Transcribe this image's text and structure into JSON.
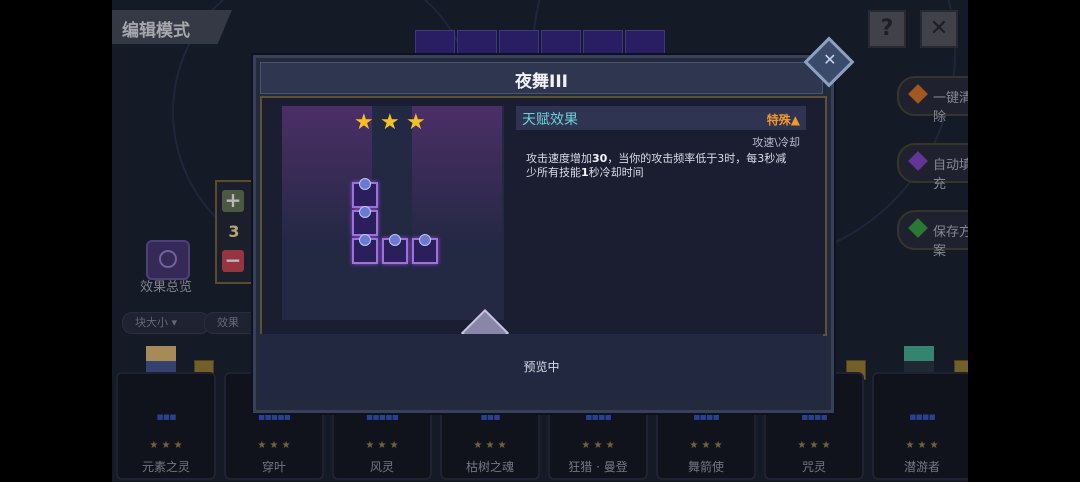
{
  "header": {
    "mode_title": "编辑模式",
    "help_label": "?",
    "close_label": "✕"
  },
  "right_actions": [
    {
      "label": "一键清除",
      "color": "#e07a2a"
    },
    {
      "label": "自动填充",
      "color": "#8a4ad0"
    },
    {
      "label": "保存方案",
      "color": "#3aa84a"
    }
  ],
  "stepper": {
    "plus": "+",
    "value": "3",
    "minus": "−"
  },
  "effect_summary": {
    "label": "效果总览"
  },
  "filters": [
    {
      "label": "块大小 ▾"
    },
    {
      "label": "效果"
    }
  ],
  "cards": [
    {
      "name": "元素之灵",
      "stars": "★ ★ ★",
      "shape": "▪▪▪"
    },
    {
      "name": "穿叶",
      "stars": "★ ★ ★",
      "shape": "▪▪▪▪▪"
    },
    {
      "name": "风灵",
      "stars": "★ ★ ★",
      "shape": "▪▪▪▪▪"
    },
    {
      "name": "枯树之魂",
      "stars": "★ ★ ★",
      "shape": "▪▪▪"
    },
    {
      "name": "狂猎 · 曼登",
      "stars": "★ ★ ★",
      "shape": "▪▪▪▪"
    },
    {
      "name": "舞箭使",
      "stars": "★ ★ ★",
      "shape": "▪▪▪▪"
    },
    {
      "name": "咒灵",
      "stars": "★ ★ ★",
      "shape": "▪▪▪▪"
    },
    {
      "name": "潜游者",
      "stars": "★ ★ ★",
      "shape": "▪▪▪▪"
    }
  ],
  "dialog": {
    "title": "夜舞III",
    "rating_stars": 3,
    "talent_label": "天赋效果",
    "special_label": "特殊▲",
    "tags": "攻速\\冷却",
    "desc_parts": {
      "p1": "攻击速度增加",
      "n1": "30",
      "p2": "，当你的攻击频率低于3时，每3秒减少所有技能",
      "n2": "1",
      "p3": "秒冷却时间"
    },
    "footer": "预览中"
  },
  "colors": {
    "accent_cyan": "#6ed0d8",
    "special_orange": "#f0962a",
    "star_gold": "#f4c028",
    "piece_purple": "#a070e0"
  }
}
